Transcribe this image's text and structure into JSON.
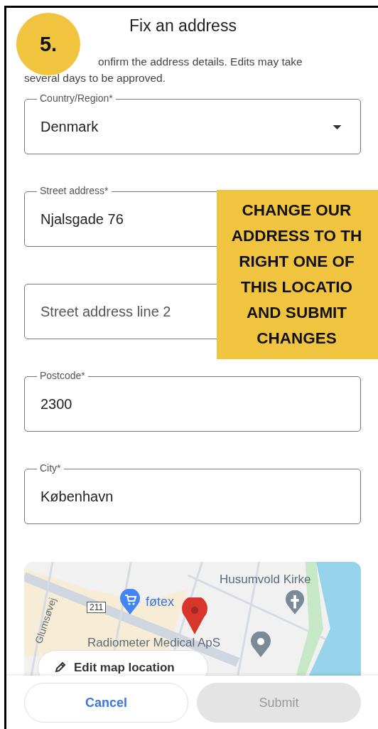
{
  "step_badge": "5.",
  "title": "Fix an address",
  "intro": "onfirm the address details. Edits may take several days to be approved.",
  "fields": [
    {
      "kind": "select",
      "label": "Country/Region*",
      "value": "Denmark"
    },
    {
      "kind": "text",
      "label": "Street address*",
      "value": "Njalsgade 76"
    },
    {
      "kind": "text",
      "placeholder": "Street address line 2"
    },
    {
      "kind": "text",
      "label": "Postcode*",
      "value": "2300"
    },
    {
      "kind": "text",
      "label": "City*",
      "value": "København"
    }
  ],
  "callout": [
    "CHANGE OUR",
    "ADDRESS TO TH",
    "RIGHT ONE OF",
    "THIS LOCATIO",
    "AND SUBMIT",
    "CHANGES"
  ],
  "map": {
    "labels": {
      "church": "Husumvold Kirke",
      "shop": "føtex",
      "road_number": "211",
      "street": "Glumsøvej",
      "business": "Radiometer Medical ApS"
    },
    "edit_button": "Edit map location"
  },
  "buttons": [
    {
      "label": "Cancel",
      "disabled": false
    },
    {
      "label": "Submit",
      "disabled": true
    }
  ]
}
